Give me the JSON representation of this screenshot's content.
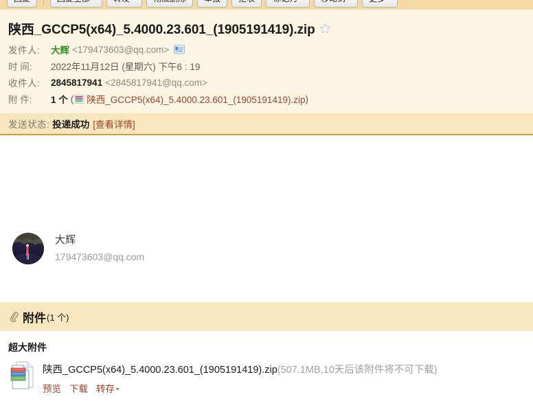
{
  "toolbar": {
    "buttons": [
      {
        "label": "回复",
        "caret": false
      },
      {
        "label": "回复全部",
        "caret": true
      },
      {
        "label": "转发",
        "caret": true
      },
      {
        "label": "彻底删除",
        "caret": false
      },
      {
        "label": "举报",
        "caret": false
      },
      {
        "label": "拒收",
        "caret": false
      },
      {
        "label": "标记为",
        "caret": true
      },
      {
        "label": "移动到",
        "caret": true
      },
      {
        "label": "更多",
        "caret": true
      }
    ],
    "separator_after_index": 0
  },
  "mail": {
    "subject": "陕西_GCCP5(x64)_5.4000.23.601_(1905191419).zip",
    "star_icon": "star-outline-icon",
    "fields": {
      "from_label": "发件人:",
      "from_name": "大辉",
      "from_address": "<179473603@qq.com>",
      "from_card_icon": "contact-card-icon",
      "time_label": "时 间:",
      "time_value": "2022年11月12日 (星期六) 下午6 : 19",
      "to_label": "收件人:",
      "to_name": "2845817941",
      "to_address": "<2845817941@qq.com>",
      "attach_label": "附 件:",
      "attach_count": "1 个",
      "attach_open_paren": "(",
      "attach_icon": "zip-file-icon",
      "attach_name": "陕西_GCCP5(x64)_5.4000.23.601_(1905191419).zip",
      "attach_close_paren": ")"
    },
    "status": {
      "label": "发送状态:",
      "value": "投递成功",
      "detail_link": "[查看详情]"
    },
    "contact": {
      "avatar_icon": "user-avatar-photo",
      "name": "大辉",
      "email": "179473603@qq.com"
    }
  },
  "attachments": {
    "band_icon": "paperclip-icon",
    "band_title": "附件",
    "band_count": "(1 个)",
    "group_title": "超大附件",
    "items": [
      {
        "icon": "zip-file-icon",
        "name": "陕西_GCCP5(x64)_5.4000.23.601_(1905191419).zip",
        "info": "(507.1MB,10天后该附件将不可下载)",
        "actions": [
          {
            "label": "预览",
            "caret": false
          },
          {
            "label": "下载",
            "caret": false
          },
          {
            "label": "转存",
            "caret": true
          }
        ],
        "caret_glyph": "▾"
      }
    ]
  },
  "colors": {
    "header_bg": "#fdf5e3",
    "strip_bg": "#f8e6bf",
    "strip_border": "#d79b3c",
    "toolbar_bg": "#f5d9a3",
    "link": "#a1422a",
    "sender_green": "#2f8f1e",
    "muted": "#8a8a84"
  }
}
